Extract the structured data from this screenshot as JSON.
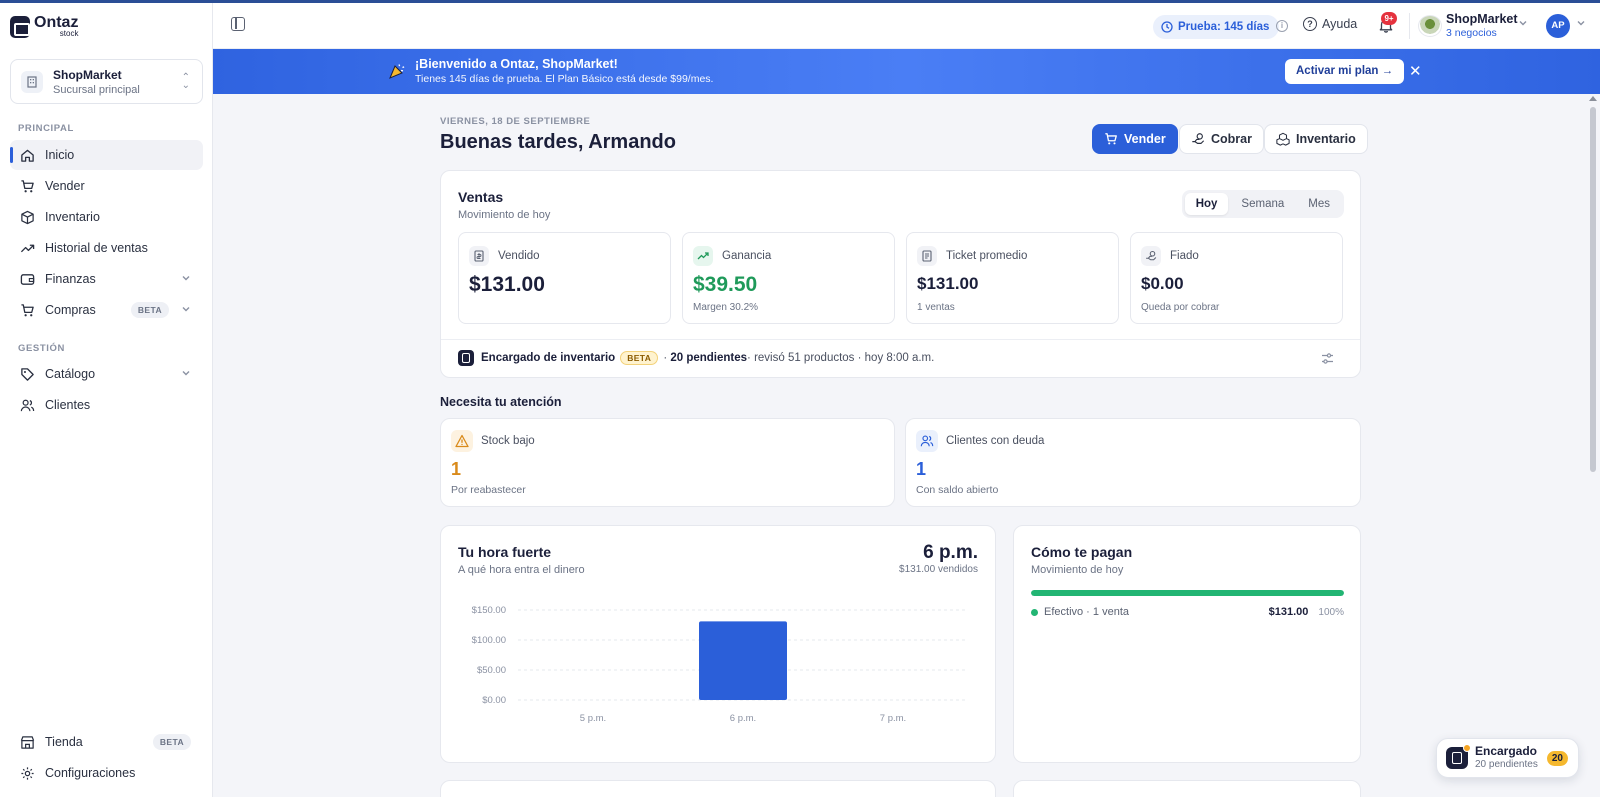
{
  "app": {
    "name": "Ontaz",
    "sub": "stock"
  },
  "branch": {
    "name": "ShopMarket",
    "sub": "Sucursal principal"
  },
  "sidebar": {
    "principal_label": "PRINCIPAL",
    "gestion_label": "GESTIÓN",
    "items": [
      {
        "label": "Inicio",
        "icon": "home-icon",
        "active": true
      },
      {
        "label": "Vender",
        "icon": "cart-icon"
      },
      {
        "label": "Inventario",
        "icon": "box-icon"
      },
      {
        "label": "Historial de ventas",
        "icon": "trend-icon"
      },
      {
        "label": "Finanzas",
        "icon": "wallet-icon"
      },
      {
        "label": "Compras",
        "icon": "cart-icon",
        "badge": "BETA"
      },
      {
        "label": "Catálogo",
        "icon": "tag-icon"
      },
      {
        "label": "Clientes",
        "icon": "users-icon"
      }
    ],
    "bottom": [
      {
        "label": "Tienda",
        "icon": "store-icon",
        "badge": "BETA"
      },
      {
        "label": "Configuraciones",
        "icon": "gear-icon"
      }
    ]
  },
  "topbar": {
    "trial": "Prueba: 145 días",
    "help": "Ayuda",
    "notifications_badge": "9+",
    "business_name": "ShopMarket",
    "business_count": "3 negocios",
    "user_initials": "AP"
  },
  "banner": {
    "title": "¡Bienvenido a Ontaz, ShopMarket!",
    "subtitle": "Tienes 145 días de prueba. El Plan Básico está desde $99/mes.",
    "cta": "Activar mi plan →",
    "close": "✕"
  },
  "header": {
    "date": "VIERNES, 18 DE SEPTIEMBRE",
    "greeting": "Buenas tardes, Armando",
    "actions": [
      "Vender",
      "Cobrar",
      "Inventario"
    ]
  },
  "sales": {
    "title": "Ventas",
    "subtitle": "Movimiento de hoy",
    "periods": [
      "Hoy",
      "Semana",
      "Mes"
    ],
    "stats": [
      {
        "label": "Vendido",
        "value": "$131.00",
        "note": ""
      },
      {
        "label": "Ganancia",
        "value": "$39.50",
        "note": "Margen 30.2%"
      },
      {
        "label": "Ticket promedio",
        "value": "$131.00",
        "note": "1 ventas"
      },
      {
        "label": "Fiado",
        "value": "$0.00",
        "note": "Queda por cobrar"
      }
    ],
    "encargado": {
      "title": "Encargado de inventario",
      "badge": "BETA",
      "pending": "20 pendientes",
      "detail": " · revisó 51 productos · hoy 8:00 a.m."
    }
  },
  "attention": {
    "title": "Necesita tu atención",
    "cards": [
      {
        "label": "Stock bajo",
        "value": "1",
        "note": "Por reabastecer",
        "color": "#d98a1a"
      },
      {
        "label": "Clientes con deuda",
        "value": "1",
        "note": "Con saldo abierto",
        "color": "#2b5fd9"
      }
    ]
  },
  "peak": {
    "title": "Tu hora fuerte",
    "subtitle": "A qué hora entra el dinero",
    "value": "6 p.m.",
    "note": "$131.00 vendidos"
  },
  "chart_data": {
    "type": "bar",
    "categories": [
      "5 p.m.",
      "6 p.m.",
      "7 p.m."
    ],
    "values": [
      0,
      131,
      0
    ],
    "ylim": [
      0,
      150
    ],
    "yticks": [
      0,
      50,
      100,
      150
    ],
    "ytick_labels": [
      "$0.00",
      "$50.00",
      "$100.00",
      "$150.00"
    ],
    "grid": true,
    "bar_color": "#2b5fd9"
  },
  "payments": {
    "title": "Cómo te pagan",
    "subtitle": "Movimiento de hoy",
    "methods": [
      {
        "label": "Efectivo · 1 venta",
        "amount": "$131.00",
        "pct": "100%",
        "share": 1.0
      }
    ]
  },
  "floating": {
    "title": "Encargado",
    "sub": "20 pendientes",
    "badge": "20"
  },
  "colors": {
    "accent": "#2b5fd9",
    "green": "#1f9a5a",
    "warning": "#d98a1a"
  }
}
